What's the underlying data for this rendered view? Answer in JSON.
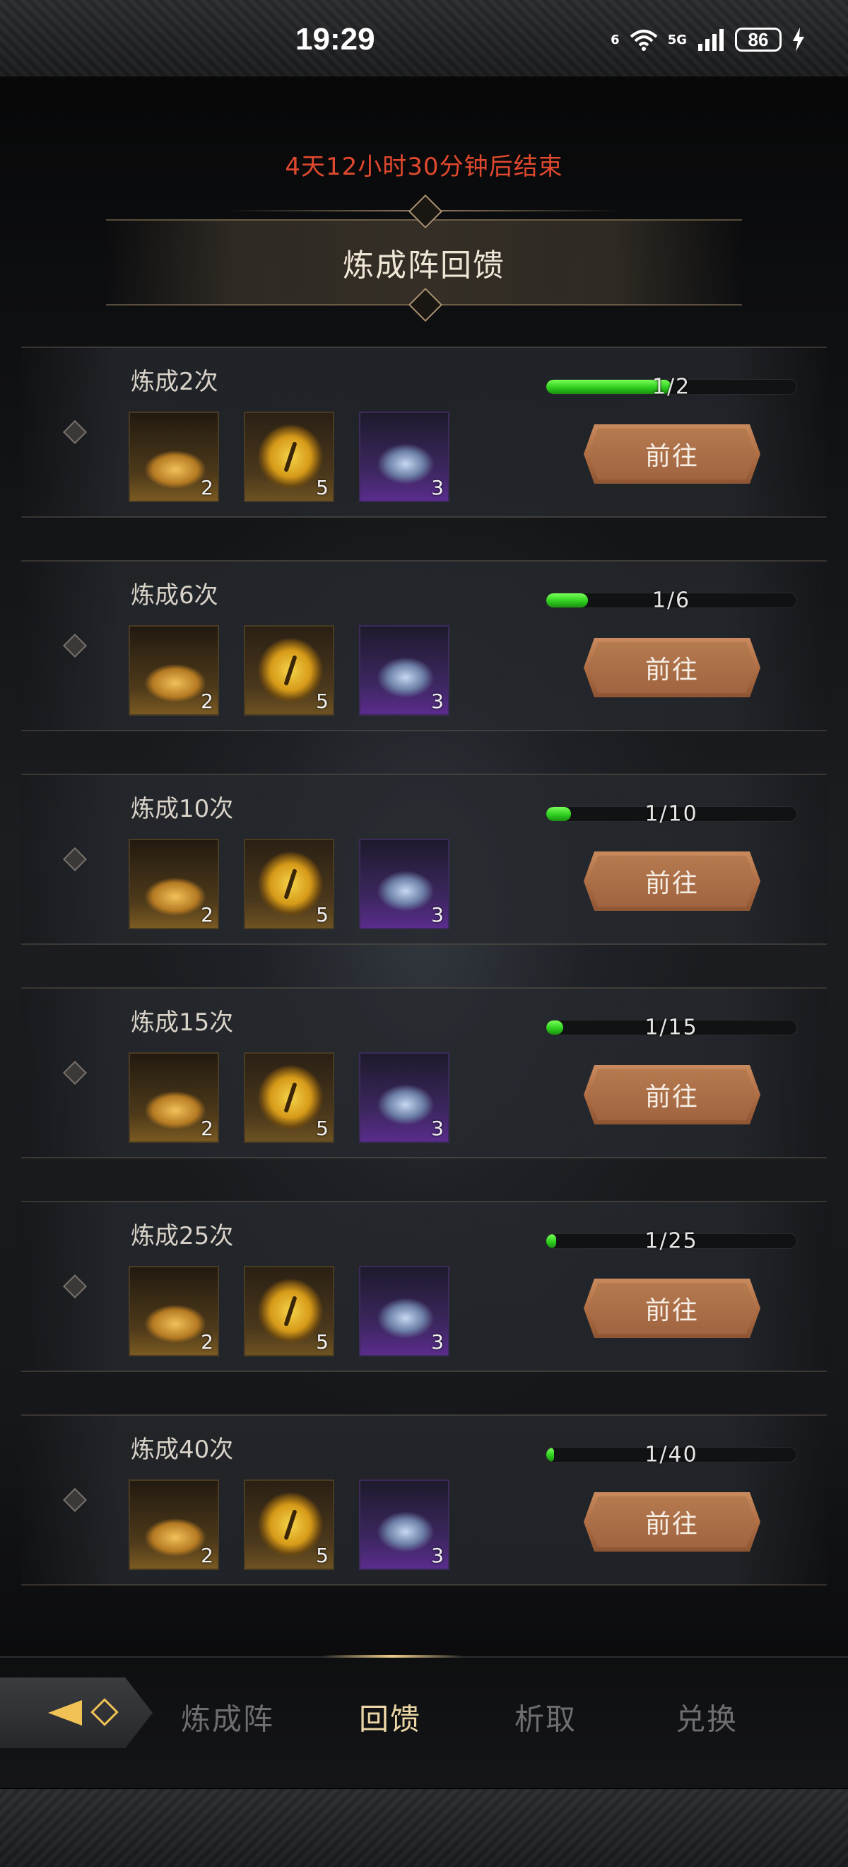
{
  "status_bar": {
    "time": "19:29",
    "wifi_label": "6",
    "cellular_label": "5G",
    "battery": "86",
    "icons": [
      "wifi-icon",
      "cellular-signal-icon",
      "battery-icon",
      "charging-bolt-icon"
    ]
  },
  "countdown": "4天12小时30分钟后结束",
  "title": "炼成阵回馈",
  "rows": [
    {
      "label": "炼成2次",
      "progress_text": "1/2",
      "progress_fraction": 0.5,
      "items": [
        {
          "icon": "gold-dust-icon",
          "count": "2"
        },
        {
          "icon": "golden-eye-icon",
          "count": "5"
        },
        {
          "icon": "purple-crystal-icon",
          "count": "3"
        }
      ],
      "button": "前往"
    },
    {
      "label": "炼成6次",
      "progress_text": "1/6",
      "progress_fraction": 0.1667,
      "items": [
        {
          "icon": "gold-dust-icon",
          "count": "2"
        },
        {
          "icon": "golden-eye-icon",
          "count": "5"
        },
        {
          "icon": "purple-crystal-icon",
          "count": "3"
        }
      ],
      "button": "前往"
    },
    {
      "label": "炼成10次",
      "progress_text": "1/10",
      "progress_fraction": 0.1,
      "items": [
        {
          "icon": "gold-dust-icon",
          "count": "2"
        },
        {
          "icon": "golden-eye-icon",
          "count": "5"
        },
        {
          "icon": "purple-crystal-icon",
          "count": "3"
        }
      ],
      "button": "前往"
    },
    {
      "label": "炼成15次",
      "progress_text": "1/15",
      "progress_fraction": 0.0667,
      "items": [
        {
          "icon": "gold-dust-icon",
          "count": "2"
        },
        {
          "icon": "golden-eye-icon",
          "count": "5"
        },
        {
          "icon": "purple-crystal-icon",
          "count": "3"
        }
      ],
      "button": "前往"
    },
    {
      "label": "炼成25次",
      "progress_text": "1/25",
      "progress_fraction": 0.04,
      "items": [
        {
          "icon": "gold-dust-icon",
          "count": "2"
        },
        {
          "icon": "golden-eye-icon",
          "count": "5"
        },
        {
          "icon": "purple-crystal-icon",
          "count": "3"
        }
      ],
      "button": "前往"
    },
    {
      "label": "炼成40次",
      "progress_text": "1/40",
      "progress_fraction": 0.025,
      "items": [
        {
          "icon": "gold-dust-icon",
          "count": "2"
        },
        {
          "icon": "golden-eye-icon",
          "count": "5"
        },
        {
          "icon": "purple-crystal-icon",
          "count": "3"
        }
      ],
      "button": "前往"
    }
  ],
  "tabs": [
    {
      "label": "炼成阵",
      "active": false
    },
    {
      "label": "回馈",
      "active": true
    },
    {
      "label": "析取",
      "active": false
    },
    {
      "label": "兑换",
      "active": false
    }
  ],
  "colors": {
    "countdown": "#e0492e",
    "progress_fill": "#2fcf1f",
    "button": "#b06f45",
    "active_tab": "#ecd6a6",
    "inactive_tab": "#6e6e70"
  }
}
